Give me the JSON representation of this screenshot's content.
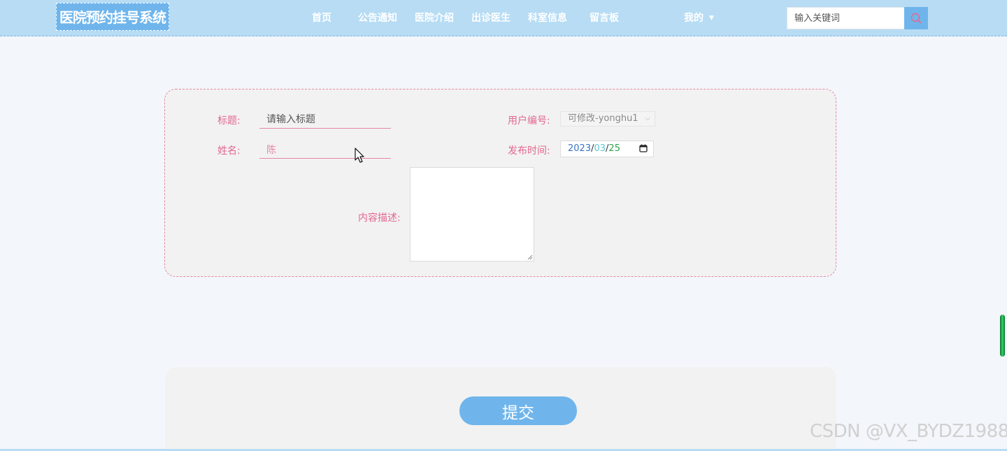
{
  "header": {
    "logo": "医院预约挂号系统",
    "nav": [
      {
        "label": "首页"
      },
      {
        "label": "公告通知"
      },
      {
        "label": "医院介绍"
      },
      {
        "label": "出诊医生"
      },
      {
        "label": "科室信息"
      },
      {
        "label": "留言板"
      }
    ],
    "user_menu": {
      "label": "我的"
    },
    "search": {
      "placeholder": "输入关键词"
    }
  },
  "form": {
    "title_label": "标题:",
    "title_placeholder": "请输入标题",
    "name_label": "姓名:",
    "name_value": "陈",
    "user_id_label": "用户编号:",
    "user_id_value": "可修改-yonghu1",
    "publish_time_label": "发布时间:",
    "date": {
      "year": "2023",
      "month": "03",
      "day": "25"
    },
    "content_label": "内容描述:"
  },
  "submit_label": "提交",
  "watermark": "CSDN @VX_BYDZ1988",
  "colors": {
    "accent": "#6fb5ec",
    "label": "#e2688f",
    "header": "#b7dcf4"
  }
}
